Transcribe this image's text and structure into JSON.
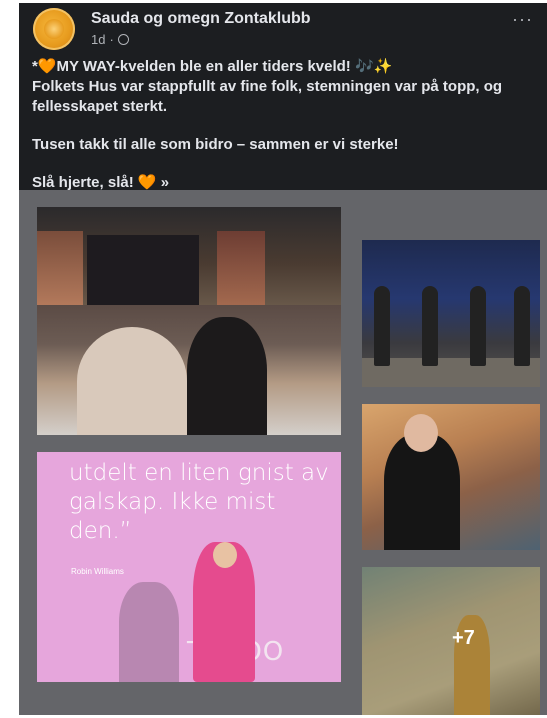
{
  "post": {
    "page_name": "Sauda og omegn Zontaklubb",
    "time": "1d",
    "separator": "·",
    "more_menu": "···",
    "text_line1": "*🧡MY WAY-kvelden ble en aller tiders kveld! 🎶✨",
    "text_line2": "Folkets Hus var stappfullt av fine folk, stemningen var på topp, og fellesskapet sterkt.",
    "text_para2": "Tusen takk til alle som bidro – sammen er vi sterke!",
    "text_para3": "Slå hjerte, slå! 🧡 »",
    "avatar_icon": "rose-logo",
    "privacy_icon": "globe-icon"
  },
  "gallery": {
    "quote": "utdelt en liten gnist av galskap. Ikke mist den.”",
    "quote_author": "Robin Williams",
    "slide_logo": "TAGOO",
    "more_count": "+7"
  },
  "colors": {
    "post_bg": "#1c1e21",
    "gallery_bg": "#646569",
    "text": "#e4e6eb",
    "secondary_text": "#b0b3b8",
    "accent_orange": "#f29a2e"
  }
}
